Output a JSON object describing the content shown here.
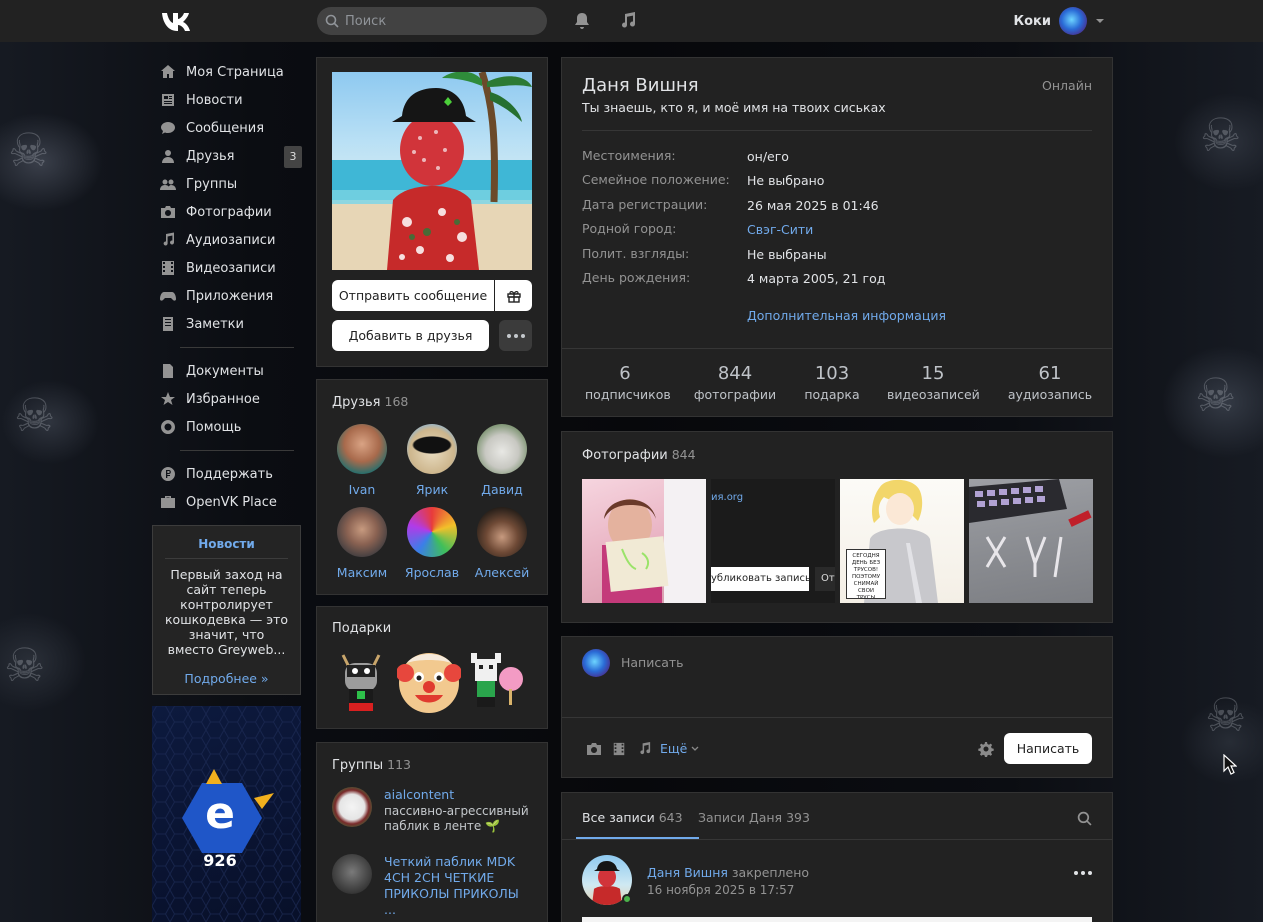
{
  "header": {
    "search_placeholder": "Поиск",
    "user_name": "Коки"
  },
  "nav": {
    "items": [
      {
        "label": "Моя Страница",
        "icon": "home-icon"
      },
      {
        "label": "Новости",
        "icon": "news-icon"
      },
      {
        "label": "Сообщения",
        "icon": "messages-icon"
      },
      {
        "label": "Друзья",
        "icon": "friends-icon",
        "badge": "3"
      },
      {
        "label": "Группы",
        "icon": "groups-icon"
      },
      {
        "label": "Фотографии",
        "icon": "camera-icon"
      },
      {
        "label": "Аудиозаписи",
        "icon": "music-note-icon"
      },
      {
        "label": "Видеозаписи",
        "icon": "film-icon"
      },
      {
        "label": "Приложения",
        "icon": "gamepad-icon"
      },
      {
        "label": "Заметки",
        "icon": "notes-icon"
      }
    ],
    "items2": [
      {
        "label": "Документы",
        "icon": "document-icon"
      },
      {
        "label": "Избранное",
        "icon": "star-icon"
      },
      {
        "label": "Помощь",
        "icon": "lifebuoy-icon"
      }
    ],
    "items3": [
      {
        "label": "Поддержать",
        "icon": "ruble-icon"
      },
      {
        "label": "OpenVK Place",
        "icon": "briefcase-icon"
      }
    ]
  },
  "news_box": {
    "title": "Новости",
    "text": "Первый заход на сайт теперь контролирует кошкодевка — это значит, что вместо Greyweb...",
    "more": "Подробнее »"
  },
  "profile": {
    "send_message": "Отправить сообщение",
    "add_friend": "Добавить в друзья"
  },
  "friends": {
    "title": "Друзья",
    "count": "168",
    "list": [
      "Ivan",
      "Ярик",
      "Давид",
      "Максим",
      "Ярослав",
      "Алексей"
    ]
  },
  "gifts": {
    "title": "Подарки"
  },
  "groups": {
    "title": "Группы",
    "count": "113",
    "list": [
      {
        "name": "aialcontent",
        "desc": "пассивно-агрессивный паблик в ленте 🌱"
      },
      {
        "name": "Четкий паблик MDK 4CH 2CH ЧЕТКИЕ ПРИКОЛЫ ПРИКОЛЫ ...",
        "desc": ""
      }
    ]
  },
  "info": {
    "name": "Даня Вишня",
    "online": "Онлайн",
    "status": "Ты знаешь, кто я, и моё имя на твоих сиськах",
    "rows": [
      {
        "label": "Местоимения:",
        "value": "он/его"
      },
      {
        "label": "Семейное положение:",
        "value": "Не выбрано"
      },
      {
        "label": "Дата регистрации:",
        "value": "26 мая 2025 в 01:46"
      },
      {
        "label": "Родной город:",
        "value": "Свэг-Сити"
      },
      {
        "label": "Полит. взгляды:",
        "value": "Не выбраны"
      },
      {
        "label": "День рождения:",
        "value": "4 марта 2005, 21 год"
      }
    ],
    "more_link": "Дополнительная информация",
    "counters": [
      {
        "num": "6",
        "label": "подписчиков"
      },
      {
        "num": "844",
        "label": "фотографии"
      },
      {
        "num": "103",
        "label": "подарка"
      },
      {
        "num": "15",
        "label": "видеозаписей"
      },
      {
        "num": "61",
        "label": "аудиозапись"
      }
    ]
  },
  "photos": {
    "title": "Фотографии",
    "count": "844",
    "thumb2_url_text": "ия.org",
    "thumb2_button": "убликовать запись",
    "thumb2_button2": "От",
    "thumb3_caption": "СЕГОДНЯ ДЕНЬ БЕЗ ТРУСОВ! ПОЭТОМУ СНИМАЙ СВОИ ТРУСЫ БЫСТРЕЕ!"
  },
  "write": {
    "placeholder": "Написать",
    "more": "Ещё",
    "submit": "Написать"
  },
  "wall": {
    "tab_all": "Все записи",
    "tab_all_count": "643",
    "tab_own": "Записи Даня",
    "tab_own_count": "393",
    "post_author": "Даня Вишня",
    "post_pinned": "закреплено",
    "post_date": "16 ноября 2025 в 17:57"
  },
  "colors": {
    "accent": "#71aaeb",
    "card_bg": "#222222",
    "header_bg": "#222222"
  }
}
